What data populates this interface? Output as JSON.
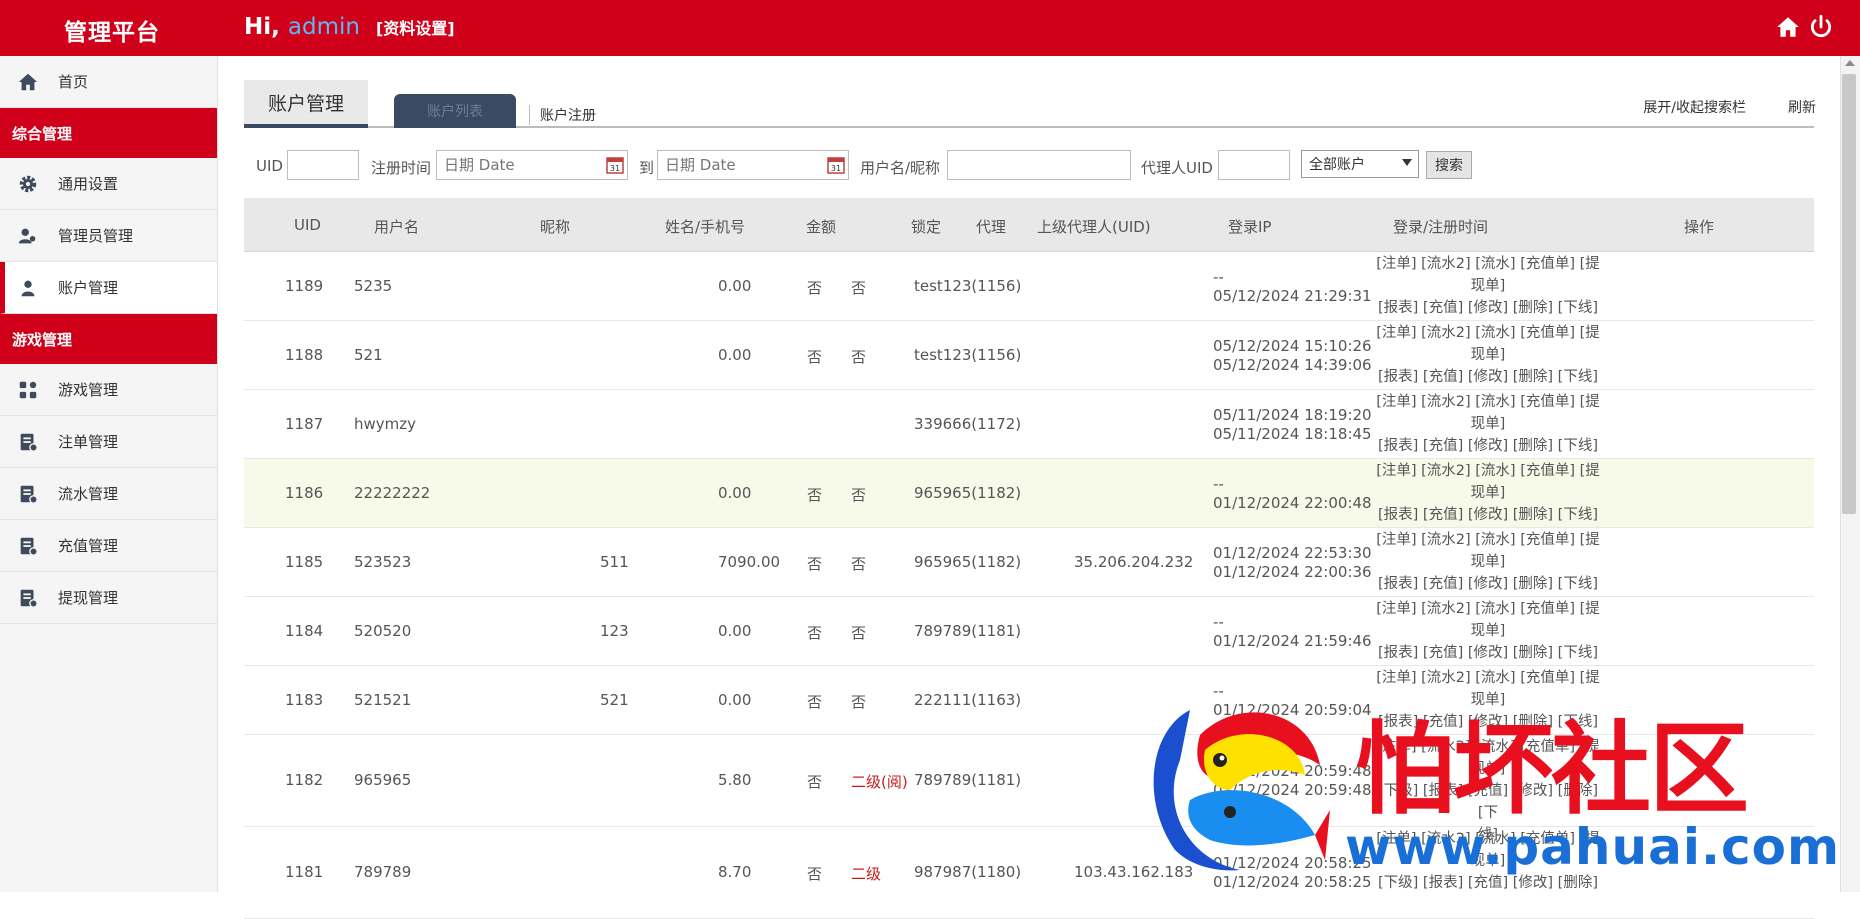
{
  "header": {
    "brand": "管理平台",
    "greeting_prefix": "Hi,",
    "username": "admin",
    "profile_link": "[资料设置]"
  },
  "sidebar": {
    "home": "首页",
    "group1": "综合管理",
    "general_settings": "通用设置",
    "admin_mgmt": "管理员管理",
    "account_mgmt": "账户管理",
    "group2": "游戏管理",
    "game_mgmt": "游戏管理",
    "bet_mgmt": "注单管理",
    "flow_mgmt": "流水管理",
    "recharge_mgmt": "充值管理",
    "withdraw_mgmt": "提现管理"
  },
  "tabs": {
    "main": "账户管理",
    "list": "账户列表",
    "register": "账户注册",
    "toggle_search": "展开/收起搜索栏",
    "refresh": "刷新"
  },
  "filters": {
    "uid_label": "UID",
    "reg_time_label": "注册时间",
    "date_placeholder": "日期 Date",
    "to_label": "到",
    "username_label": "用户名/昵称",
    "agent_uid_label": "代理人UID",
    "account_select": "全部账户",
    "search_button": "搜索"
  },
  "table": {
    "headers": [
      "UID",
      "用户名",
      "昵称",
      "姓名/手机号",
      "金额",
      "锁定",
      "代理",
      "上级代理人(UID)",
      "登录IP",
      "登录/注册时间",
      "操作"
    ],
    "ops_line1": "[注单] [流水2] [流水] [充值单] [提",
    "ops_line2": "现单]",
    "ops_line3": "[报表] [充值] [修改] [删除] [下线]",
    "rows": [
      {
        "uid": "1189",
        "username": "5235",
        "name": "",
        "amount": "0.00",
        "locked": "否",
        "agent": "否",
        "parent": "test123(1156)",
        "ip": "",
        "login_time": "--",
        "reg_time": "05/12/2024 21:29:31"
      },
      {
        "uid": "1188",
        "username": "521",
        "name": "",
        "amount": "0.00",
        "locked": "否",
        "agent": "否",
        "parent": "test123(1156)",
        "ip": "",
        "login_time": "05/12/2024 15:10:26",
        "reg_time": "05/12/2024 14:39:06"
      },
      {
        "uid": "1187",
        "username": "hwymzy",
        "name": "",
        "amount": "",
        "locked": "",
        "agent": "",
        "parent": "339666(1172)",
        "ip": "",
        "login_time": "05/11/2024 18:19:20",
        "reg_time": "05/11/2024 18:18:45"
      },
      {
        "uid": "1186",
        "username": "22222222",
        "name": "",
        "amount": "0.00",
        "locked": "否",
        "agent": "否",
        "parent": "965965(1182)",
        "ip": "",
        "login_time": "--",
        "reg_time": "01/12/2024 22:00:48"
      },
      {
        "uid": "1185",
        "username": "523523",
        "name": "511",
        "amount": "7090.00",
        "locked": "否",
        "agent": "否",
        "parent": "965965(1182)",
        "ip": "35.206.204.232",
        "login_time": "01/12/2024 22:53:30",
        "reg_time": "01/12/2024 22:00:36"
      },
      {
        "uid": "1184",
        "username": "520520",
        "name": "123",
        "amount": "0.00",
        "locked": "否",
        "agent": "否",
        "parent": "789789(1181)",
        "ip": "",
        "login_time": "--",
        "reg_time": "01/12/2024 21:59:46"
      },
      {
        "uid": "1183",
        "username": "521521",
        "name": "521",
        "amount": "0.00",
        "locked": "否",
        "agent": "否",
        "parent": "222111(1163)",
        "ip": "",
        "login_time": "--",
        "reg_time": "01/12/2024 20:59:04"
      },
      {
        "uid": "1182",
        "username": "965965",
        "name": "",
        "amount": "5.80",
        "locked": "否",
        "agent": "二级(阅)",
        "parent": "789789(1181)",
        "ip": "",
        "login_time": "01/12/2024 20:59:48",
        "reg_time": "01/12/2024 20:59:48"
      },
      {
        "uid": "1181",
        "username": "789789",
        "name": "",
        "amount": "8.70",
        "locked": "否",
        "agent": "二级",
        "parent": "987987(1180)",
        "ip": "103.43.162.183",
        "login_time": "01/12/2024 20:58:25",
        "reg_time": "01/12/2024 20:58:25"
      }
    ],
    "ops_alt_line1": "[下级] [报表] [充值] [修改] [删除] [下",
    "ops_alt_line2": "线]",
    "ops_alt_line3": "[下级] [报表] [充值] [修改] [删除]"
  },
  "watermark": {
    "text": "怕坏社区",
    "url": "www.pahuai.com"
  },
  "colors": {
    "brand_red": "#d0001a",
    "tab_dark": "#3b4a63",
    "username_blue": "#5bb8f5",
    "highlight_row": "#f7fae9"
  }
}
